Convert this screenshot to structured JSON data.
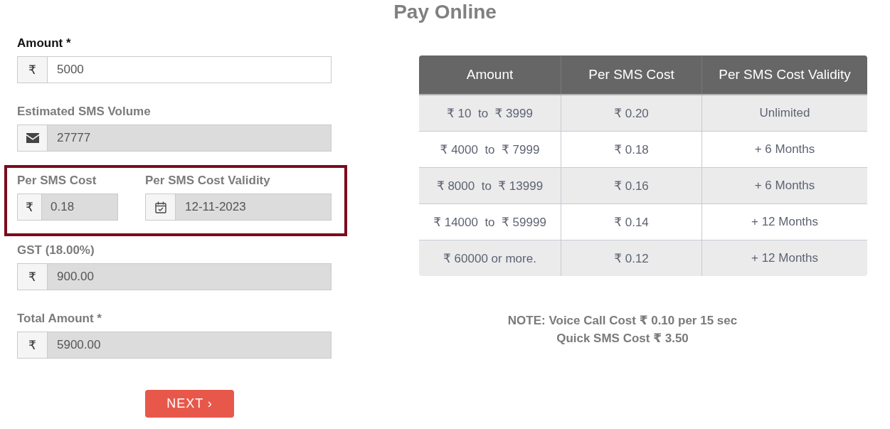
{
  "page": {
    "title": "Pay Online"
  },
  "form": {
    "rows": [
      {
        "kind": "single",
        "highlighted": false,
        "fields": [
          {
            "label": "Amount *",
            "value": "5000",
            "disabled": false,
            "addon": {
              "kind": "text",
              "text": "₹"
            }
          }
        ]
      },
      {
        "kind": "single",
        "highlighted": false,
        "fields": [
          {
            "label": "Estimated SMS Volume",
            "value": "27777",
            "disabled": true,
            "addon": {
              "kind": "envelope"
            }
          }
        ]
      },
      {
        "kind": "pair",
        "highlighted": true,
        "fields": [
          {
            "label": "Per SMS Cost",
            "value": "0.18",
            "disabled": true,
            "addon": {
              "kind": "text",
              "text": "₹"
            }
          },
          {
            "label": "Per SMS Cost Validity",
            "value": "12-11-2023",
            "disabled": true,
            "addon": {
              "kind": "calendar"
            }
          }
        ]
      },
      {
        "kind": "single",
        "highlighted": false,
        "fields": [
          {
            "label": "GST (18.00%)",
            "value": "900.00",
            "disabled": true,
            "addon": {
              "kind": "text",
              "text": "₹"
            }
          }
        ]
      },
      {
        "kind": "single",
        "highlighted": false,
        "fields": [
          {
            "label": "Total Amount *",
            "value": "5900.00",
            "disabled": true,
            "addon": {
              "kind": "text",
              "text": "₹"
            }
          }
        ]
      }
    ],
    "next_button": {
      "label": "NEXT ›"
    }
  },
  "pricing_table": {
    "columns": [
      "Amount",
      "Per SMS Cost",
      "Per SMS Cost Validity"
    ],
    "rows": [
      [
        "₹ 10  to  ₹ 3999",
        "₹ 0.20",
        "Unlimited"
      ],
      [
        "₹ 4000  to  ₹ 7999",
        "₹ 0.18",
        "+ 6 Months"
      ],
      [
        "₹ 8000  to  ₹ 13999",
        "₹ 0.16",
        "+ 6 Months"
      ],
      [
        "₹ 14000  to  ₹ 59999",
        "₹ 0.14",
        "+ 12 Months"
      ],
      [
        "₹ 60000 or more.",
        "₹ 0.12",
        "+ 12 Months"
      ]
    ]
  },
  "note": {
    "lines": [
      "NOTE: Voice Call Cost ₹ 0.10 per 15 sec",
      "Quick SMS Cost ₹ 3.50"
    ]
  }
}
